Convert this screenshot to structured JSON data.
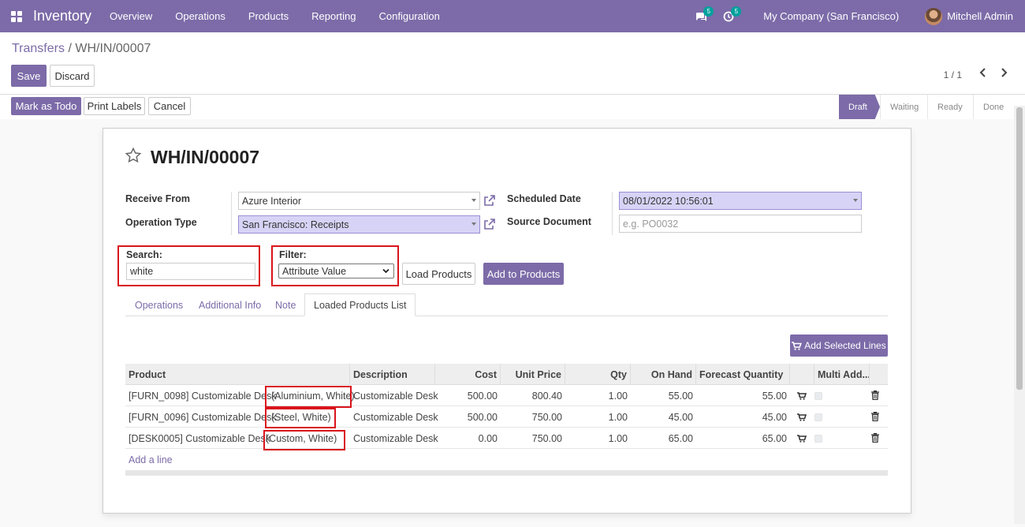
{
  "nav": {
    "app_title": "Inventory",
    "menu": [
      "Overview",
      "Operations",
      "Products",
      "Reporting",
      "Configuration"
    ],
    "messages_count": "5",
    "activities_count": "5",
    "company": "My Company (San Francisco)",
    "user": "Mitchell Admin"
  },
  "breadcrumb": {
    "parent": "Transfers",
    "separator": "/",
    "current": "WH/IN/00007"
  },
  "toolbar": {
    "save": "Save",
    "discard": "Discard"
  },
  "pager": {
    "value": "1 / 1"
  },
  "header_buttons": {
    "mark_todo": "Mark as Todo",
    "print_labels": "Print Labels",
    "cancel": "Cancel"
  },
  "status_steps": [
    "Draft",
    "Waiting",
    "Ready",
    "Done"
  ],
  "form": {
    "title": "WH/IN/00007",
    "receive_from_label": "Receive From",
    "receive_from_value": "Azure Interior",
    "operation_type_label": "Operation Type",
    "operation_type_value": "San Francisco: Receipts",
    "scheduled_date_label": "Scheduled Date",
    "scheduled_date_value": "08/01/2022 10:56:01",
    "source_document_label": "Source Document",
    "source_document_placeholder": "e.g. PO0032",
    "search_label": "Search:",
    "search_value": "white",
    "filter_label": "Filter:",
    "filter_value": "Attribute Value",
    "load_products": "Load Products",
    "add_to_products": "Add to Products"
  },
  "tabs": [
    "Operations",
    "Additional Info",
    "Note",
    "Loaded Products List"
  ],
  "add_selected_lines": "Add Selected Lines",
  "table": {
    "headers": [
      "Product",
      "Description",
      "Cost",
      "Unit Price",
      "Qty",
      "On Hand",
      "Forecast Quantity",
      "Multi Add..."
    ],
    "rows": [
      {
        "product": "[FURN_0098] Customizable Desk",
        "variant": "(Aluminium, White)",
        "description": "Customizable Desk",
        "cost": "500.00",
        "unit_price": "800.40",
        "qty": "1.00",
        "on_hand": "55.00",
        "forecast": "55.00"
      },
      {
        "product": "[FURN_0096] Customizable Desk",
        "variant": "(Steel, White)",
        "description": "Customizable Desk",
        "cost": "500.00",
        "unit_price": "750.00",
        "qty": "1.00",
        "on_hand": "45.00",
        "forecast": "45.00"
      },
      {
        "product": "[DESK0005] Customizable Desk",
        "variant": "(Custom, White)",
        "description": "Customizable Desk",
        "cost": "0.00",
        "unit_price": "750.00",
        "qty": "1.00",
        "on_hand": "65.00",
        "forecast": "65.00"
      }
    ],
    "add_line": "Add a line"
  }
}
